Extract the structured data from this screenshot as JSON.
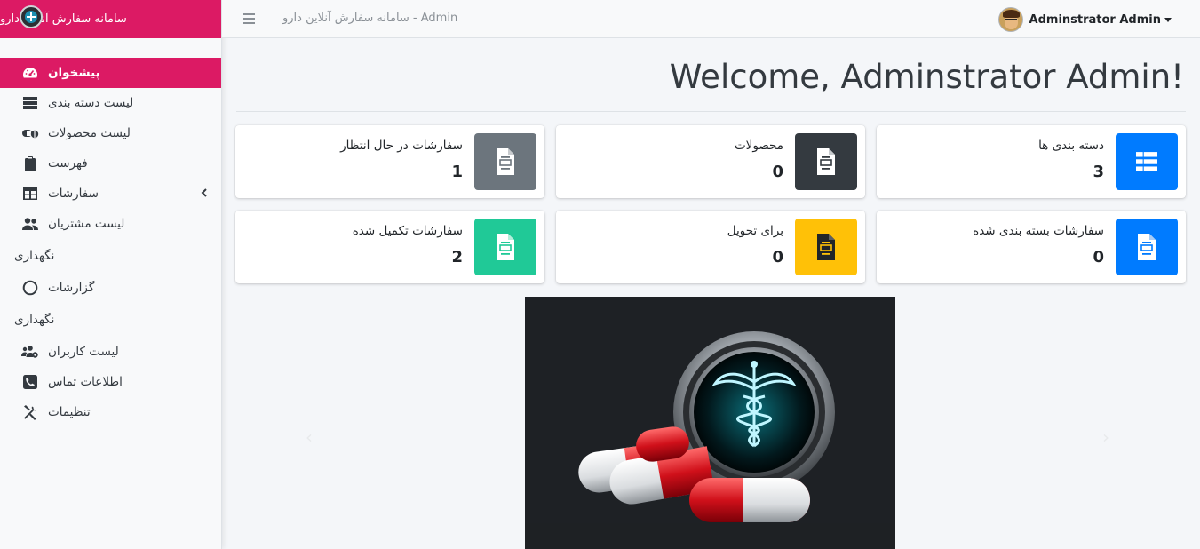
{
  "brand": {
    "title": "سامانه سفارش آنلاین دارو",
    "logo_icon": "caduceus-icon"
  },
  "sidebar": {
    "items": [
      {
        "label": "پیشخوان",
        "icon": "dashboard-icon",
        "active": true
      },
      {
        "label": "لیست دسته بندی",
        "icon": "list-icon"
      },
      {
        "label": "لیست محصولات",
        "icon": "pills-icon"
      },
      {
        "label": "فهرست",
        "icon": "clipboard-icon"
      },
      {
        "label": "سفارشات",
        "icon": "table-icon",
        "has_submenu": true
      },
      {
        "label": "لیست مشتریان",
        "icon": "users-icon"
      }
    ],
    "section1": {
      "header": "نگهداری",
      "items": [
        {
          "label": "گزارشات",
          "icon": "circle-icon"
        }
      ]
    },
    "section2": {
      "header": "نگهداری",
      "items": [
        {
          "label": "لیست کاربران",
          "icon": "users-cog-icon"
        },
        {
          "label": "اطلاعات تماس",
          "icon": "phone-icon"
        },
        {
          "label": "تنظیمات",
          "icon": "tools-icon"
        }
      ]
    }
  },
  "topbar": {
    "title": "سامانه سفارش آنلاین دارو - Admin",
    "user_name": "Adminstrator Admin"
  },
  "main": {
    "welcome": "Welcome, Adminstrator Admin!",
    "cards": [
      {
        "label": "دسته بندی ها",
        "value": "3",
        "color": "#007bff"
      },
      {
        "label": "محصولات",
        "value": "0",
        "color": "#343a40"
      },
      {
        "label": "سفارشات در حال انتظار",
        "value": "1",
        "color": "#6c757d"
      },
      {
        "label": "سفارشات بسته بندی شده",
        "value": "0",
        "color": "#007bff"
      },
      {
        "label": "برای تحویل",
        "value": "0",
        "color": "#ffc107"
      },
      {
        "label": "سفارشات تکمیل شده",
        "value": "2",
        "color": "#20c997"
      }
    ]
  },
  "colors": {
    "accent": "#dc1a64"
  }
}
